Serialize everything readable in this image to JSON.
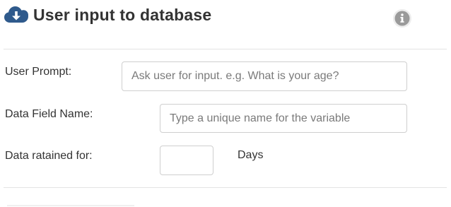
{
  "header": {
    "title": "User input to database",
    "title_icon": "cloud-download-icon",
    "info_icon": "info-icon"
  },
  "colors": {
    "accent": "#2f5a8c",
    "text": "#333333",
    "border": "#cfcfcf",
    "info_icon": "#9a9a9a"
  },
  "form": {
    "user_prompt": {
      "label": "User Prompt:",
      "value": "",
      "placeholder": "Ask user for input. e.g. What is your age?"
    },
    "data_field_name": {
      "label": "Data Field Name:",
      "value": "",
      "placeholder": "Type a unique name for the variable"
    },
    "data_retained": {
      "label": "Data ratained for:",
      "value": "",
      "unit": "Days"
    }
  }
}
